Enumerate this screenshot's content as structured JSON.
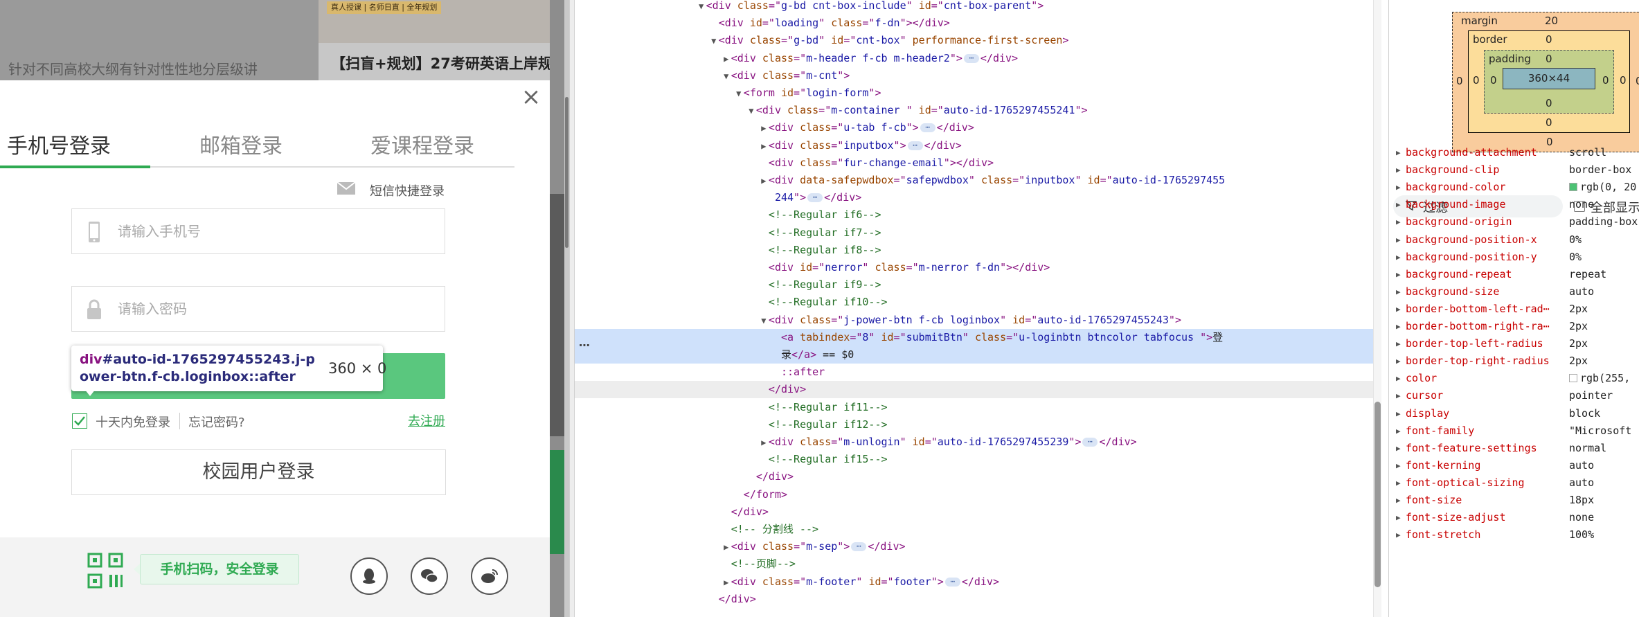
{
  "page": {
    "bg_text": "针对不同高校大纲有针对性性地分层级讲",
    "ad_badge": "真人授课 | 名师日直 | 全年规划",
    "ad_title": "【扫盲+规划】27考研英语上岸规划营"
  },
  "login": {
    "close_label": "×",
    "tabs": [
      "手机号登录",
      "邮箱登录",
      "爱课程登录"
    ],
    "active_tab": 0,
    "sms_label": "短信快捷登录",
    "phone_placeholder": "请输入手机号",
    "password_placeholder": "请输入密码",
    "remember_label": "十天内免登录",
    "forgot_label": "忘记密码?",
    "register_label": "去注册",
    "campus_label": "校园用户登录",
    "qr_tip": "手机扫码，安全登录",
    "accent_color": "#2faa52",
    "login_button_color": "#5ac77e"
  },
  "tooltip": {
    "tag": "div",
    "selector": "#auto-id-1765297455243.j-power-btn.f-cb.loginbox::after",
    "size": "360 × 0"
  },
  "dom": {
    "selected_dots": "⋯",
    "lines": [
      {
        "indent": 21,
        "tri": "▼",
        "html": [
          [
            "tg",
            "<div "
          ],
          [
            "an",
            "class"
          ],
          [
            "tg",
            "=\""
          ],
          [
            "av",
            "g-bd cnt-box-include"
          ],
          [
            "tg",
            "\" "
          ],
          [
            "an",
            "id"
          ],
          [
            "tg",
            "=\""
          ],
          [
            "av",
            "cnt-box-parent"
          ],
          [
            "tg",
            "\">"
          ]
        ]
      },
      {
        "indent": 23,
        "tri": "",
        "html": [
          [
            "tg",
            "<div "
          ],
          [
            "an",
            "id"
          ],
          [
            "tg",
            "=\""
          ],
          [
            "av",
            "loading"
          ],
          [
            "tg",
            "\" "
          ],
          [
            "an",
            "class"
          ],
          [
            "tg",
            "=\""
          ],
          [
            "av",
            "f-dn"
          ],
          [
            "tg",
            "\"></div>"
          ]
        ]
      },
      {
        "indent": 23,
        "tri": "▼",
        "html": [
          [
            "tg",
            "<div "
          ],
          [
            "an",
            "class"
          ],
          [
            "tg",
            "=\""
          ],
          [
            "av",
            "g-bd"
          ],
          [
            "tg",
            "\" "
          ],
          [
            "an",
            "id"
          ],
          [
            "tg",
            "=\""
          ],
          [
            "av",
            "cnt-box"
          ],
          [
            "tg",
            "\" "
          ],
          [
            "an",
            "performance-first-screen"
          ],
          [
            "tg",
            ">"
          ]
        ]
      },
      {
        "indent": 25,
        "tri": "▶",
        "html": [
          [
            "tg",
            "<div "
          ],
          [
            "an",
            "class"
          ],
          [
            "tg",
            "=\""
          ],
          [
            "av",
            "m-header f-cb m-header2"
          ],
          [
            "tg",
            "\">"
          ],
          [
            "ell",
            "⋯"
          ],
          [
            "tg",
            "</div>"
          ]
        ]
      },
      {
        "indent": 25,
        "tri": "▼",
        "html": [
          [
            "tg",
            "<div "
          ],
          [
            "an",
            "class"
          ],
          [
            "tg",
            "=\""
          ],
          [
            "av",
            "m-cnt"
          ],
          [
            "tg",
            "\">"
          ]
        ]
      },
      {
        "indent": 27,
        "tri": "▼",
        "html": [
          [
            "tg",
            "<form "
          ],
          [
            "an",
            "id"
          ],
          [
            "tg",
            "=\""
          ],
          [
            "av",
            "login-form"
          ],
          [
            "tg",
            "\">"
          ]
        ]
      },
      {
        "indent": 29,
        "tri": "▼",
        "html": [
          [
            "tg",
            "<div "
          ],
          [
            "an",
            "class"
          ],
          [
            "tg",
            "=\""
          ],
          [
            "av",
            "m-container "
          ],
          [
            "tg",
            "\" "
          ],
          [
            "an",
            "id"
          ],
          [
            "tg",
            "=\""
          ],
          [
            "av",
            "auto-id-1765297455241"
          ],
          [
            "tg",
            "\">"
          ]
        ]
      },
      {
        "indent": 31,
        "tri": "▶",
        "html": [
          [
            "tg",
            "<div "
          ],
          [
            "an",
            "class"
          ],
          [
            "tg",
            "=\""
          ],
          [
            "av",
            "u-tab f-cb"
          ],
          [
            "tg",
            "\">"
          ],
          [
            "ell",
            "⋯"
          ],
          [
            "tg",
            "</div>"
          ]
        ]
      },
      {
        "indent": 31,
        "tri": "▶",
        "html": [
          [
            "tg",
            "<div "
          ],
          [
            "an",
            "class"
          ],
          [
            "tg",
            "=\""
          ],
          [
            "av",
            "inputbox"
          ],
          [
            "tg",
            "\">"
          ],
          [
            "ell",
            "⋯"
          ],
          [
            "tg",
            "</div>"
          ]
        ]
      },
      {
        "indent": 31,
        "tri": "",
        "html": [
          [
            "tg",
            "<div "
          ],
          [
            "an",
            "class"
          ],
          [
            "tg",
            "=\""
          ],
          [
            "av",
            "fur-change-email"
          ],
          [
            "tg",
            "\"></div>"
          ]
        ]
      },
      {
        "indent": 31,
        "tri": "▶",
        "html": [
          [
            "tg",
            "<div "
          ],
          [
            "an",
            "data-safepwdbox"
          ],
          [
            "tg",
            "=\""
          ],
          [
            "av",
            "safepwdbox"
          ],
          [
            "tg",
            "\" "
          ],
          [
            "an",
            "class"
          ],
          [
            "tg",
            "=\""
          ],
          [
            "av",
            "inputbox"
          ],
          [
            "tg",
            "\" "
          ],
          [
            "an",
            "id"
          ],
          [
            "tg",
            "=\""
          ],
          [
            "av",
            "auto-id-1765297455"
          ]
        ]
      },
      {
        "indent": 32,
        "tri": "",
        "html": [
          [
            "av",
            "244"
          ],
          [
            "tg",
            "\">"
          ],
          [
            "ell",
            "⋯"
          ],
          [
            "tg",
            "</div>"
          ]
        ]
      },
      {
        "indent": 31,
        "tri": "",
        "html": [
          [
            "cm",
            "<!--Regular if6-->"
          ]
        ]
      },
      {
        "indent": 31,
        "tri": "",
        "html": [
          [
            "cm",
            "<!--Regular if7-->"
          ]
        ]
      },
      {
        "indent": 31,
        "tri": "",
        "html": [
          [
            "cm",
            "<!--Regular if8-->"
          ]
        ]
      },
      {
        "indent": 31,
        "tri": "",
        "html": [
          [
            "tg",
            "<div "
          ],
          [
            "an",
            "id"
          ],
          [
            "tg",
            "=\""
          ],
          [
            "av",
            "nerror"
          ],
          [
            "tg",
            "\" "
          ],
          [
            "an",
            "class"
          ],
          [
            "tg",
            "=\""
          ],
          [
            "av",
            "m-nerror f-dn"
          ],
          [
            "tg",
            "\"></div>"
          ]
        ]
      },
      {
        "indent": 31,
        "tri": "",
        "html": [
          [
            "cm",
            "<!--Regular if9-->"
          ]
        ]
      },
      {
        "indent": 31,
        "tri": "",
        "html": [
          [
            "cm",
            "<!--Regular if10-->"
          ]
        ]
      },
      {
        "indent": 31,
        "tri": "▼",
        "html": [
          [
            "tg",
            "<div "
          ],
          [
            "an",
            "class"
          ],
          [
            "tg",
            "=\""
          ],
          [
            "av",
            "j-power-btn f-cb loginbox"
          ],
          [
            "tg",
            "\" "
          ],
          [
            "an",
            "id"
          ],
          [
            "tg",
            "=\""
          ],
          [
            "av",
            "auto-id-1765297455243"
          ],
          [
            "tg",
            "\">"
          ]
        ]
      },
      {
        "indent": 33,
        "tri": "",
        "html": [
          [
            "tg",
            "<a "
          ],
          [
            "an",
            "tabindex"
          ],
          [
            "tg",
            "=\""
          ],
          [
            "av",
            "8"
          ],
          [
            "tg",
            "\" "
          ],
          [
            "an",
            "id"
          ],
          [
            "tg",
            "=\""
          ],
          [
            "av",
            "submitBtn"
          ],
          [
            "tg",
            "\" "
          ],
          [
            "an",
            "class"
          ],
          [
            "tg",
            "=\""
          ],
          [
            "av",
            "u-loginbtn btncolor tabfocus "
          ],
          [
            "tg",
            "\">"
          ],
          [
            "tx",
            "登"
          ]
        ],
        "cls": "selected"
      },
      {
        "indent": 33,
        "tri": "",
        "html": [
          [
            "tx",
            "录"
          ],
          [
            "tg",
            "</a>"
          ],
          [
            "tx",
            " == $0"
          ]
        ],
        "cls": "selected-2"
      },
      {
        "indent": 33,
        "tri": "",
        "html": [
          [
            "ps",
            "::after"
          ]
        ]
      },
      {
        "indent": 31,
        "tri": "",
        "html": [
          [
            "tg",
            "</div>"
          ]
        ],
        "cls": "hover"
      },
      {
        "indent": 31,
        "tri": "",
        "html": [
          [
            "cm",
            "<!--Regular if11-->"
          ]
        ]
      },
      {
        "indent": 31,
        "tri": "",
        "html": [
          [
            "cm",
            "<!--Regular if12-->"
          ]
        ]
      },
      {
        "indent": 31,
        "tri": "▶",
        "html": [
          [
            "tg",
            "<div "
          ],
          [
            "an",
            "class"
          ],
          [
            "tg",
            "=\""
          ],
          [
            "av",
            "m-unlogin"
          ],
          [
            "tg",
            "\" "
          ],
          [
            "an",
            "id"
          ],
          [
            "tg",
            "=\""
          ],
          [
            "av",
            "auto-id-1765297455239"
          ],
          [
            "tg",
            "\">"
          ],
          [
            "ell",
            "⋯"
          ],
          [
            "tg",
            "</div>"
          ]
        ]
      },
      {
        "indent": 31,
        "tri": "",
        "html": [
          [
            "cm",
            "<!--Regular if15-->"
          ]
        ]
      },
      {
        "indent": 29,
        "tri": "",
        "html": [
          [
            "tg",
            "</div>"
          ]
        ]
      },
      {
        "indent": 27,
        "tri": "",
        "html": [
          [
            "tg",
            "</form>"
          ]
        ]
      },
      {
        "indent": 25,
        "tri": "",
        "html": [
          [
            "tg",
            "</div>"
          ]
        ]
      },
      {
        "indent": 25,
        "tri": "",
        "html": [
          [
            "cm",
            "<!-- 分割线 -->"
          ]
        ]
      },
      {
        "indent": 25,
        "tri": "▶",
        "html": [
          [
            "tg",
            "<div "
          ],
          [
            "an",
            "class"
          ],
          [
            "tg",
            "=\""
          ],
          [
            "av",
            "m-sep"
          ],
          [
            "tg",
            "\">"
          ],
          [
            "ell",
            "⋯"
          ],
          [
            "tg",
            "</div>"
          ]
        ]
      },
      {
        "indent": 25,
        "tri": "",
        "html": [
          [
            "cm",
            "<!--页脚-->"
          ]
        ]
      },
      {
        "indent": 25,
        "tri": "▶",
        "html": [
          [
            "tg",
            "<div "
          ],
          [
            "an",
            "class"
          ],
          [
            "tg",
            "=\""
          ],
          [
            "av",
            "m-footer"
          ],
          [
            "tg",
            "\" "
          ],
          [
            "an",
            "id"
          ],
          [
            "tg",
            "=\""
          ],
          [
            "av",
            "footer"
          ],
          [
            "tg",
            "\">"
          ],
          [
            "ell",
            "⋯"
          ],
          [
            "tg",
            "</div>"
          ]
        ]
      },
      {
        "indent": 23,
        "tri": "",
        "html": [
          [
            "tg",
            "</div>"
          ]
        ]
      }
    ]
  },
  "boxmodel": {
    "margin_label": "margin",
    "margin_top": "20",
    "margin_bottom": "0",
    "margin_left": "0",
    "margin_right": "0",
    "border_label": "border",
    "border_top": "0",
    "border_bottom": "0",
    "border_left": "0",
    "border_right": "0",
    "padding_label": "padding",
    "padding_top": "0",
    "padding_bottom": "0",
    "padding_left": "0",
    "padding_right": "0",
    "content": "360×44"
  },
  "styles": {
    "filter_label": "过滤",
    "show_all_label": "全部显示",
    "props": [
      {
        "name": "background-attachment",
        "value": "scroll"
      },
      {
        "name": "background-clip",
        "value": "border-box"
      },
      {
        "name": "background-color",
        "value": "rgb(0, 20",
        "swatch": "#4cc274"
      },
      {
        "name": "background-image",
        "value": "none"
      },
      {
        "name": "background-origin",
        "value": "padding-box"
      },
      {
        "name": "background-position-x",
        "value": "0%"
      },
      {
        "name": "background-position-y",
        "value": "0%"
      },
      {
        "name": "background-repeat",
        "value": "repeat"
      },
      {
        "name": "background-size",
        "value": "auto"
      },
      {
        "name": "border-bottom-left-rad⋯",
        "value": "2px"
      },
      {
        "name": "border-bottom-right-ra⋯",
        "value": "2px"
      },
      {
        "name": "border-top-left-radius",
        "value": "2px"
      },
      {
        "name": "border-top-right-radius",
        "value": "2px"
      },
      {
        "name": "color",
        "value": "rgb(255,",
        "swatch": "#ffffff"
      },
      {
        "name": "cursor",
        "value": "pointer"
      },
      {
        "name": "display",
        "value": "block"
      },
      {
        "name": "font-family",
        "value": "\"Microsoft"
      },
      {
        "name": "font-feature-settings",
        "value": "normal"
      },
      {
        "name": "font-kerning",
        "value": "auto"
      },
      {
        "name": "font-optical-sizing",
        "value": "auto"
      },
      {
        "name": "font-size",
        "value": "18px"
      },
      {
        "name": "font-size-adjust",
        "value": "none"
      },
      {
        "name": "font-stretch",
        "value": "100%"
      }
    ]
  }
}
